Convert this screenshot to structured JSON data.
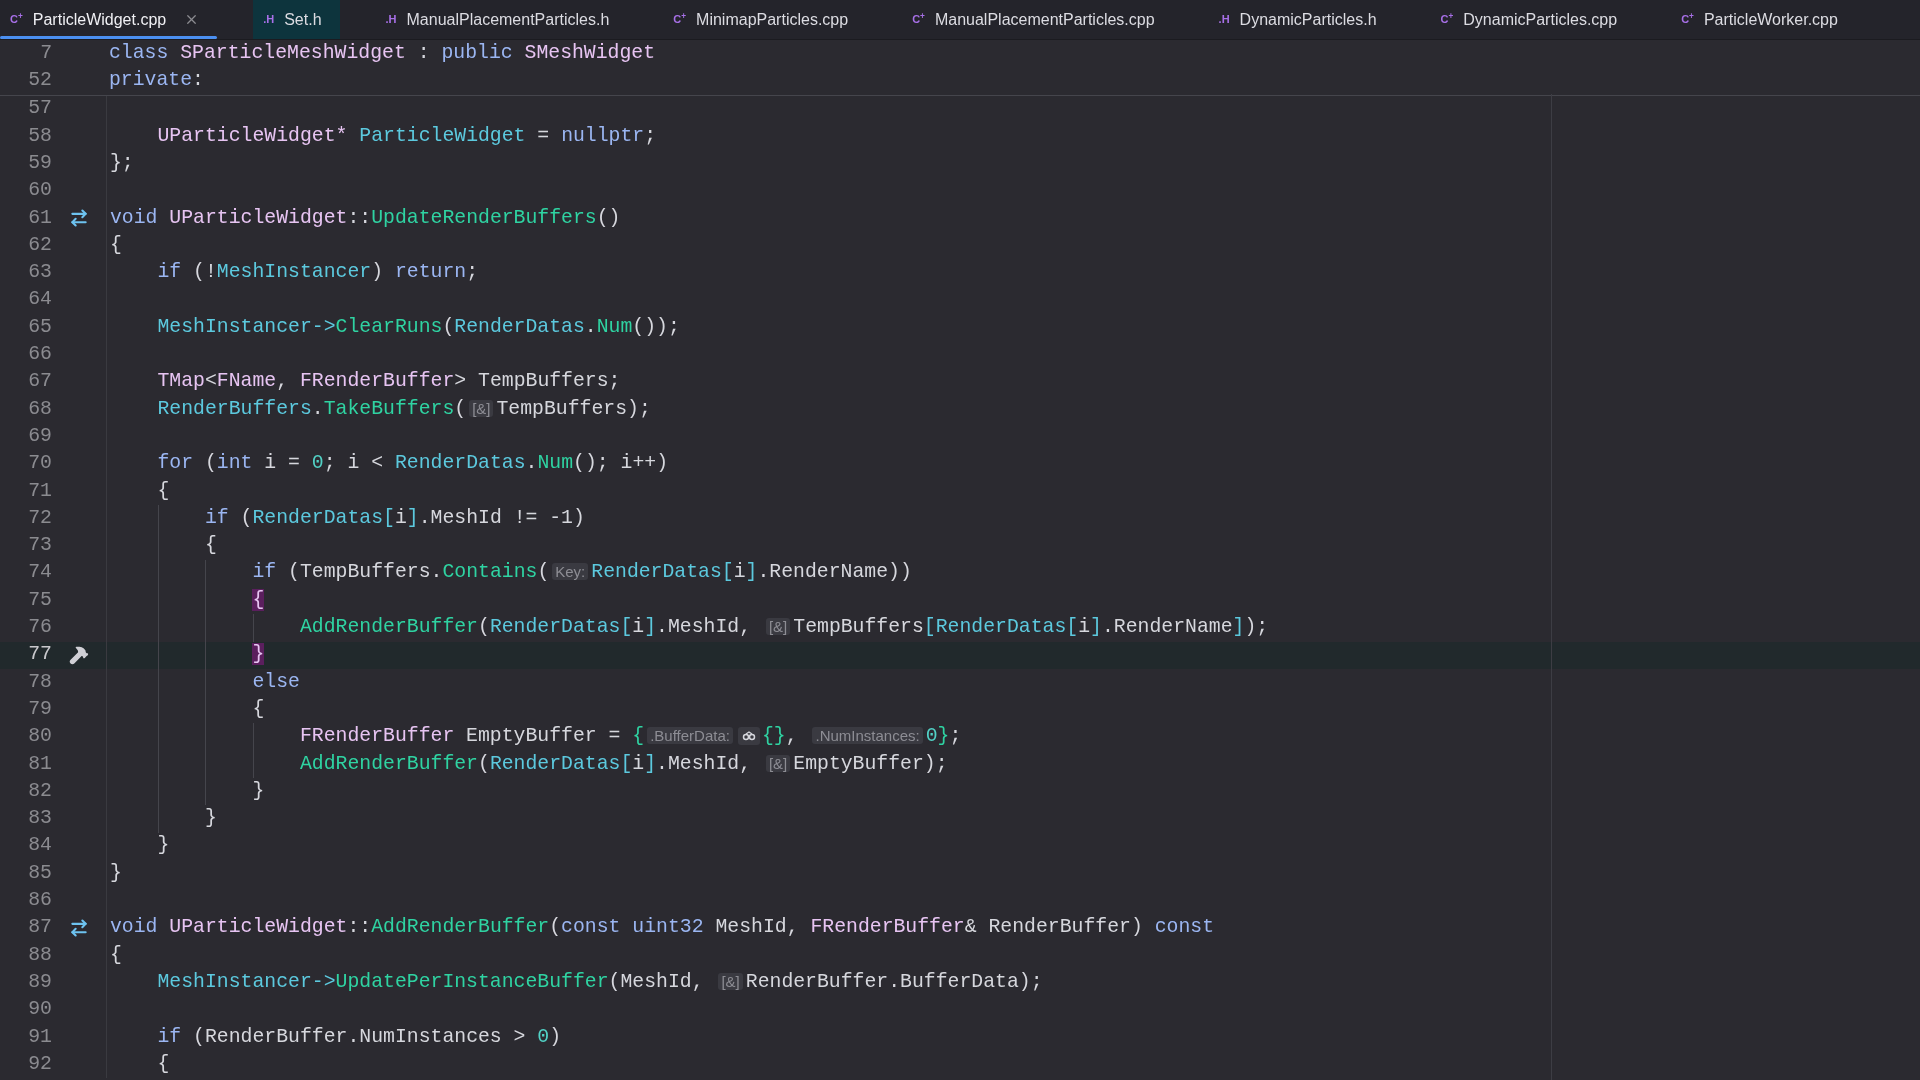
{
  "tabs": [
    {
      "label": "ParticleWidget.cpp",
      "icon": "C$^{+}$",
      "selected": true,
      "highlighted": false,
      "closable": true
    },
    {
      "label": "Set.h",
      "icon": ".H",
      "selected": false,
      "highlighted": true,
      "closable": false
    },
    {
      "label": "ManualPlacementParticles.h",
      "icon": ".H",
      "selected": false,
      "highlighted": false,
      "closable": false
    },
    {
      "label": "MinimapParticles.cpp",
      "icon": "C$^{+}$",
      "selected": false,
      "highlighted": false,
      "closable": false
    },
    {
      "label": "ManualPlacementParticles.cpp",
      "icon": "C$^{+}$",
      "selected": false,
      "highlighted": false,
      "closable": false
    },
    {
      "label": "DynamicParticles.h",
      "icon": ".H",
      "selected": false,
      "highlighted": false,
      "closable": false
    },
    {
      "label": "DynamicParticles.cpp",
      "icon": "C$^{+}$",
      "selected": false,
      "highlighted": false,
      "closable": false
    },
    {
      "label": "ParticleWorker.cpp",
      "icon": "C$^{+}$",
      "selected": false,
      "highlighted": false,
      "closable": false
    }
  ],
  "sticky_lines": [
    {
      "number": "7",
      "tokens": [
        {
          "kind": "kw",
          "text": "class "
        },
        {
          "kind": "type",
          "text": "SParticleMeshWidget"
        },
        {
          "kind": "plain",
          "text": " : "
        },
        {
          "kind": "kw",
          "text": "public "
        },
        {
          "kind": "type",
          "text": "SMeshWidget"
        }
      ]
    },
    {
      "number": "52",
      "tokens": [
        {
          "kind": "kw",
          "text": "private"
        },
        {
          "kind": "plain",
          "text": ":"
        }
      ]
    }
  ],
  "lines": [
    {
      "number": "57",
      "kind": "code",
      "current": false
    },
    {
      "number": "58",
      "kind": "code",
      "current": false,
      "tokens": [
        {
          "kind": "type",
          "text": "    UParticleWidget* "
        },
        {
          "kind": "var",
          "text": "ParticleWidget"
        },
        {
          "kind": "plain",
          "text": " = "
        },
        {
          "kind": "kw",
          "text": "nullptr"
        },
        {
          "kind": "plain",
          "text": ";"
        }
      ]
    },
    {
      "number": "59",
      "kind": "code",
      "current": false,
      "tokens": [
        {
          "kind": "plain",
          "text": "};"
        }
      ]
    },
    {
      "number": "60",
      "kind": "code",
      "current": false
    },
    {
      "number": "61",
      "kind": "override",
      "current": false,
      "tokens": [
        {
          "kind": "kw",
          "text": "void "
        },
        {
          "kind": "type",
          "text": "UParticleWidget"
        },
        {
          "kind": "plain",
          "text": "::"
        },
        {
          "kind": "fn",
          "text": "UpdateRenderBuffers"
        },
        {
          "kind": "plain",
          "text": "()"
        }
      ]
    },
    {
      "number": "62",
      "kind": "code",
      "current": false,
      "tokens": [
        {
          "kind": "plain",
          "text": "{"
        }
      ]
    },
    {
      "number": "63",
      "kind": "code",
      "current": false,
      "tokens": [
        {
          "kind": "kw",
          "text": "    if"
        },
        {
          "kind": "plain",
          "text": " (!"
        },
        {
          "kind": "var",
          "text": "MeshInstancer"
        },
        {
          "kind": "plain",
          "text": ") "
        },
        {
          "kind": "kw",
          "text": "return"
        },
        {
          "kind": "plain",
          "text": ";"
        }
      ]
    },
    {
      "number": "64",
      "kind": "code",
      "current": false
    },
    {
      "number": "65",
      "kind": "code",
      "current": false,
      "tokens": [
        {
          "kind": "var",
          "text": "    MeshInstancer->"
        },
        {
          "kind": "fn",
          "text": "ClearRuns"
        },
        {
          "kind": "plain",
          "text": "("
        },
        {
          "kind": "var",
          "text": "RenderDatas"
        },
        {
          "kind": "plain",
          "text": "."
        },
        {
          "kind": "fn",
          "text": "Num"
        },
        {
          "kind": "plain",
          "text": "());"
        }
      ]
    },
    {
      "number": "66",
      "kind": "code",
      "current": false
    },
    {
      "number": "67",
      "kind": "code",
      "current": false,
      "tokens": [
        {
          "kind": "type",
          "text": "    TMap"
        },
        {
          "kind": "plain",
          "text": "<"
        },
        {
          "kind": "type",
          "text": "FName"
        },
        {
          "kind": "plain",
          "text": ", "
        },
        {
          "kind": "type",
          "text": "FRenderBuffer"
        },
        {
          "kind": "plain",
          "text": "> TempBuffers;"
        }
      ]
    },
    {
      "number": "68",
      "kind": "code",
      "current": false,
      "tokens": [
        {
          "kind": "var",
          "text": "    RenderBuffers"
        },
        {
          "kind": "plain",
          "text": "."
        },
        {
          "kind": "fn",
          "text": "TakeBuffers"
        },
        {
          "kind": "plain",
          "text": "("
        },
        {
          "kind": "hint",
          "text": "[&]"
        },
        {
          "kind": "plain",
          "text": "TempBuffers);"
        }
      ]
    },
    {
      "number": "69",
      "kind": "code",
      "current": false
    },
    {
      "number": "70",
      "kind": "code",
      "current": false,
      "tokens": [
        {
          "kind": "kw",
          "text": "    for"
        },
        {
          "kind": "plain",
          "text": " ("
        },
        {
          "kind": "kw",
          "text": "int"
        },
        {
          "kind": "plain",
          "text": " i = "
        },
        {
          "kind": "num",
          "text": "0"
        },
        {
          "kind": "plain",
          "text": "; i < "
        },
        {
          "kind": "var",
          "text": "RenderDatas"
        },
        {
          "kind": "plain",
          "text": "."
        },
        {
          "kind": "fn",
          "text": "Num"
        },
        {
          "kind": "plain",
          "text": "(); i++)"
        }
      ]
    },
    {
      "number": "71",
      "kind": "code",
      "current": false,
      "tokens": [
        {
          "kind": "plain",
          "text": "    {"
        }
      ]
    },
    {
      "number": "72",
      "kind": "code",
      "current": false,
      "tokens": [
        {
          "kind": "kw",
          "text": "        if"
        },
        {
          "kind": "plain",
          "text": " ("
        },
        {
          "kind": "var",
          "text": "RenderDatas["
        },
        {
          "kind": "plain",
          "text": "i"
        },
        {
          "kind": "var",
          "text": "]"
        },
        {
          "kind": "plain",
          "text": ".MeshId != -1)"
        }
      ]
    },
    {
      "number": "73",
      "kind": "code",
      "current": false,
      "tokens": [
        {
          "kind": "plain",
          "text": "        {"
        }
      ]
    },
    {
      "number": "74",
      "kind": "code",
      "current": false,
      "tokens": [
        {
          "kind": "kw",
          "text": "            if"
        },
        {
          "kind": "plain",
          "text": " (TempBuffers."
        },
        {
          "kind": "fn",
          "text": "Contains"
        },
        {
          "kind": "plain",
          "text": "("
        },
        {
          "kind": "hint",
          "text": "Key:"
        },
        {
          "kind": "var",
          "text": "RenderDatas["
        },
        {
          "kind": "plain",
          "text": "i"
        },
        {
          "kind": "var",
          "text": "]"
        },
        {
          "kind": "plain",
          "text": ".RenderName))"
        }
      ]
    },
    {
      "number": "75",
      "kind": "code",
      "current": false,
      "tokens": [
        {
          "kind": "brace",
          "text": "            {"
        }
      ]
    },
    {
      "number": "76",
      "kind": "code",
      "current": false,
      "tokens": [
        {
          "kind": "fn",
          "text": "                AddRenderBuffer"
        },
        {
          "kind": "plain",
          "text": "("
        },
        {
          "kind": "var",
          "text": "RenderDatas["
        },
        {
          "kind": "plain",
          "text": "i"
        },
        {
          "kind": "var",
          "text": "]"
        },
        {
          "kind": "plain",
          "text": ".MeshId, "
        },
        {
          "kind": "hint",
          "text": "[&]"
        },
        {
          "kind": "plain",
          "text": "TempBuffers"
        },
        {
          "kind": "var",
          "text": "[RenderDatas["
        },
        {
          "kind": "plain",
          "text": "i"
        },
        {
          "kind": "var",
          "text": "]"
        },
        {
          "kind": "plain",
          "text": ".RenderName"
        },
        {
          "kind": "var",
          "text": "]"
        },
        {
          "kind": "plain",
          "text": ");"
        }
      ]
    },
    {
      "number": "77",
      "kind": "build",
      "current": true,
      "tokens": [
        {
          "kind": "brace",
          "text": "            }"
        }
      ]
    },
    {
      "number": "78",
      "kind": "code",
      "current": false,
      "tokens": [
        {
          "kind": "kw",
          "text": "            else"
        }
      ]
    },
    {
      "number": "79",
      "kind": "code",
      "current": false,
      "tokens": [
        {
          "kind": "plain",
          "text": "            {"
        }
      ]
    },
    {
      "number": "80",
      "kind": "code",
      "current": false,
      "tokens": [
        {
          "kind": "type",
          "text": "                FRenderBuffer"
        },
        {
          "kind": "plain",
          "text": " EmptyBuffer = "
        },
        {
          "kind": "fn",
          "text": "{"
        },
        {
          "kind": "hint",
          "text": ".BufferData:"
        },
        {
          "kind": "hint-icon"
        },
        {
          "kind": "fn",
          "text": "{}"
        },
        {
          "kind": "plain",
          "text": ", "
        },
        {
          "kind": "hint",
          "text": ".NumInstances:"
        },
        {
          "kind": "num",
          "text": "0"
        },
        {
          "kind": "fn",
          "text": "}"
        },
        {
          "kind": "plain",
          "text": ";"
        }
      ]
    },
    {
      "number": "81",
      "kind": "code",
      "current": false,
      "tokens": [
        {
          "kind": "fn",
          "text": "                AddRenderBuffer"
        },
        {
          "kind": "plain",
          "text": "("
        },
        {
          "kind": "var",
          "text": "RenderDatas["
        },
        {
          "kind": "plain",
          "text": "i"
        },
        {
          "kind": "var",
          "text": "]"
        },
        {
          "kind": "plain",
          "text": ".MeshId, "
        },
        {
          "kind": "hint",
          "text": "[&]"
        },
        {
          "kind": "plain",
          "text": "EmptyBuffer);"
        }
      ]
    },
    {
      "number": "82",
      "kind": "code",
      "current": false,
      "tokens": [
        {
          "kind": "plain",
          "text": "            }"
        }
      ]
    },
    {
      "number": "83",
      "kind": "code",
      "current": false,
      "tokens": [
        {
          "kind": "plain",
          "text": "        }"
        }
      ]
    },
    {
      "number": "84",
      "kind": "code",
      "current": false,
      "tokens": [
        {
          "kind": "plain",
          "text": "    }"
        }
      ]
    },
    {
      "number": "85",
      "kind": "code",
      "current": false,
      "tokens": [
        {
          "kind": "plain",
          "text": "}"
        }
      ]
    },
    {
      "number": "86",
      "kind": "code",
      "current": false
    },
    {
      "number": "87",
      "kind": "override",
      "current": false,
      "tokens": [
        {
          "kind": "kw",
          "text": "void "
        },
        {
          "kind": "type",
          "text": "UParticleWidget"
        },
        {
          "kind": "plain",
          "text": "::"
        },
        {
          "kind": "fn",
          "text": "AddRenderBuffer"
        },
        {
          "kind": "plain",
          "text": "("
        },
        {
          "kind": "kw",
          "text": "const uint32"
        },
        {
          "kind": "plain",
          "text": " MeshId, "
        },
        {
          "kind": "type",
          "text": "FRenderBuffer"
        },
        {
          "kind": "plain",
          "text": "& RenderBuffer) "
        },
        {
          "kind": "kw",
          "text": "const"
        }
      ]
    },
    {
      "number": "88",
      "kind": "code",
      "current": false,
      "tokens": [
        {
          "kind": "plain",
          "text": "{"
        }
      ]
    },
    {
      "number": "89",
      "kind": "code",
      "current": false,
      "tokens": [
        {
          "kind": "var",
          "text": "    MeshInstancer->"
        },
        {
          "kind": "fn",
          "text": "UpdatePerInstanceBuffer"
        },
        {
          "kind": "plain",
          "text": "(MeshId, "
        },
        {
          "kind": "hint",
          "text": "[&]"
        },
        {
          "kind": "plain",
          "text": "RenderBuffer.BufferData);"
        }
      ]
    },
    {
      "number": "90",
      "kind": "code",
      "current": false
    },
    {
      "number": "91",
      "kind": "code",
      "current": false,
      "tokens": [
        {
          "kind": "kw",
          "text": "    if"
        },
        {
          "kind": "plain",
          "text": " (RenderBuffer.NumInstances > "
        },
        {
          "kind": "num",
          "text": "0"
        },
        {
          "kind": "plain",
          "text": ")"
        }
      ]
    },
    {
      "number": "92",
      "kind": "code",
      "current": false,
      "tokens": [
        {
          "kind": "plain",
          "text": "    {"
        }
      ]
    }
  ]
}
